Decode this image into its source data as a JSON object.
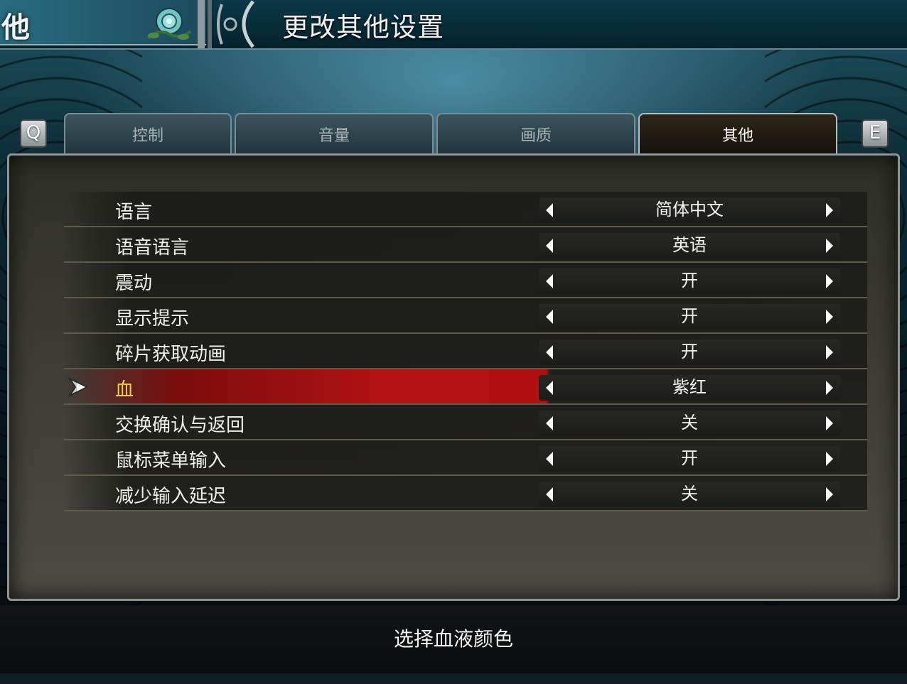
{
  "header": {
    "corner_text": "他",
    "title": "更改其他设置"
  },
  "tabs": {
    "prev_key": "Q",
    "next_key": "E",
    "items": [
      {
        "label": "控制",
        "active": false
      },
      {
        "label": "音量",
        "active": false
      },
      {
        "label": "画质",
        "active": false
      },
      {
        "label": "其他",
        "active": true
      }
    ]
  },
  "settings": [
    {
      "label": "语言",
      "value": "简体中文",
      "selected": false
    },
    {
      "label": "语音语言",
      "value": "英语",
      "selected": false
    },
    {
      "label": "震动",
      "value": "开",
      "selected": false
    },
    {
      "label": "显示提示",
      "value": "开",
      "selected": false
    },
    {
      "label": "碎片获取动画",
      "value": "开",
      "selected": false
    },
    {
      "label": "血",
      "value": "紫红",
      "selected": true
    },
    {
      "label": "交换确认与返回",
      "value": "关",
      "selected": false
    },
    {
      "label": "鼠标菜单输入",
      "value": "开",
      "selected": false
    },
    {
      "label": "减少输入延迟",
      "value": "关",
      "selected": false
    }
  ],
  "help": {
    "text": "选择血液颜色"
  },
  "colors": {
    "selected_row": "#b21212",
    "selected_label": "#f2d340",
    "active_tab_bg": "#1d180f"
  }
}
